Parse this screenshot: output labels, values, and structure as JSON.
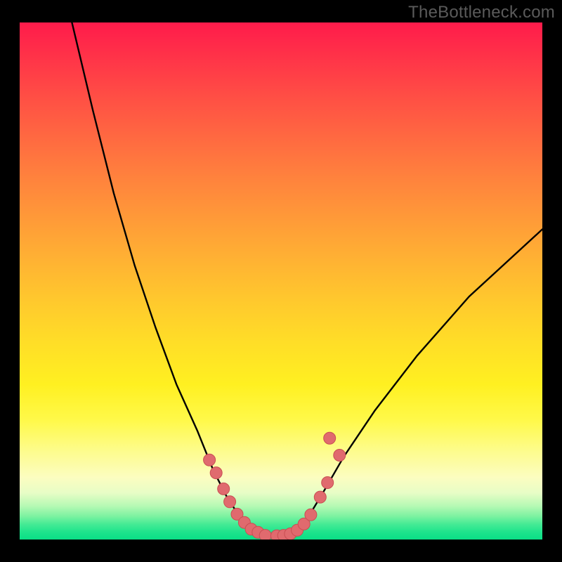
{
  "watermark": "TheBottleneck.com",
  "chart_data": {
    "type": "line",
    "title": "",
    "xlabel": "",
    "ylabel": "",
    "xlim": [
      0,
      100
    ],
    "ylim": [
      0,
      100
    ],
    "note": "Axes are unlabeled in the image; values below are percentage positions estimated from the plotted pixels. Y is inverted (0 at top of plot).",
    "series": [
      {
        "name": "left-curve",
        "x": [
          10,
          14,
          18,
          22,
          26,
          30,
          34,
          37,
          39.5,
          41.7,
          43.5,
          45
        ],
        "y": [
          0,
          17,
          33,
          47,
          59,
          70,
          79,
          86.5,
          91.5,
          95,
          97.5,
          99
        ]
      },
      {
        "name": "valley-flat",
        "x": [
          45,
          47,
          49,
          51,
          52.5
        ],
        "y": [
          99,
          99.3,
          99.4,
          99.3,
          99
        ]
      },
      {
        "name": "right-curve",
        "x": [
          52.5,
          55,
          58,
          62,
          68,
          76,
          86,
          100
        ],
        "y": [
          99,
          96,
          91,
          84,
          75,
          64.5,
          53,
          40
        ]
      }
    ],
    "markers_left": {
      "name": "left-dots",
      "x": [
        36.3,
        37.6,
        39.0,
        40.2,
        41.6,
        43.0,
        44.3,
        45.6,
        47.0
      ],
      "y": [
        84.6,
        87.1,
        90.2,
        92.7,
        95.1,
        96.7,
        98.0,
        98.6,
        99.2
      ]
    },
    "markers_right": {
      "name": "right-dots",
      "x": [
        49.2,
        50.5,
        51.8,
        53.1,
        54.4,
        55.7,
        57.5,
        58.9,
        59.3,
        61.2
      ],
      "y": [
        99.3,
        99.2,
        98.9,
        98.2,
        97.0,
        95.2,
        91.8,
        89.0,
        80.4,
        83.7
      ]
    },
    "colors": {
      "curve": "#000000",
      "marker_fill": "#e06a6e",
      "marker_stroke": "#c94e53"
    }
  }
}
